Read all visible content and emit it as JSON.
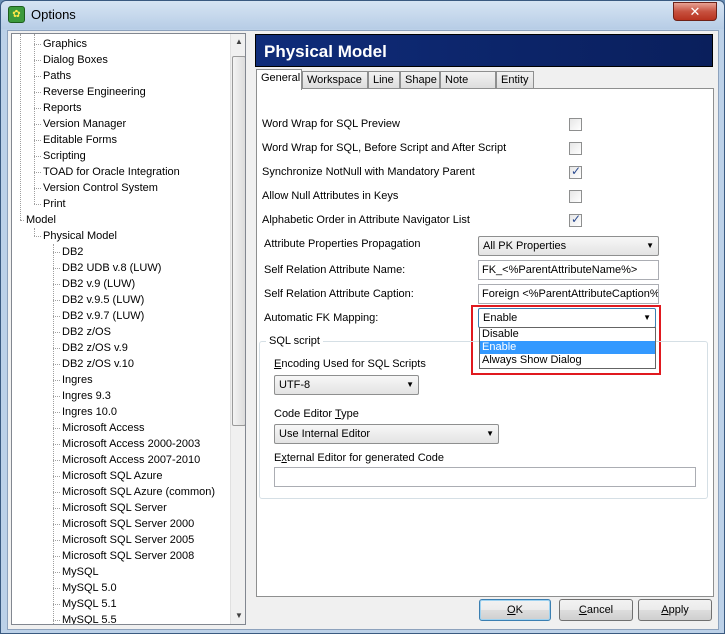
{
  "window": {
    "title": "Options",
    "icon": "erwin-app-icon",
    "close_label": "✕"
  },
  "tree": {
    "items": [
      {
        "label": "Graphics",
        "level": 2
      },
      {
        "label": "Dialog Boxes",
        "level": 2
      },
      {
        "label": "Paths",
        "level": 2
      },
      {
        "label": "Reverse Engineering",
        "level": 2
      },
      {
        "label": "Reports",
        "level": 2
      },
      {
        "label": "Version Manager",
        "level": 2
      },
      {
        "label": "Editable Forms",
        "level": 2
      },
      {
        "label": "Scripting",
        "level": 2
      },
      {
        "label": "TOAD for Oracle Integration",
        "level": 2
      },
      {
        "label": "Version Control System",
        "level": 2
      },
      {
        "label": "Print",
        "level": 2
      },
      {
        "label": "Model",
        "level": 1
      },
      {
        "label": "Physical Model",
        "level": 2
      },
      {
        "label": "DB2",
        "level": 3
      },
      {
        "label": "DB2 UDB v.8 (LUW)",
        "level": 3
      },
      {
        "label": "DB2 v.9 (LUW)",
        "level": 3
      },
      {
        "label": "DB2 v.9.5 (LUW)",
        "level": 3
      },
      {
        "label": "DB2 v.9.7 (LUW)",
        "level": 3
      },
      {
        "label": "DB2 z/OS",
        "level": 3
      },
      {
        "label": "DB2 z/OS v.9",
        "level": 3
      },
      {
        "label": "DB2 z/OS v.10",
        "level": 3
      },
      {
        "label": "Ingres",
        "level": 3
      },
      {
        "label": "Ingres 9.3",
        "level": 3
      },
      {
        "label": "Ingres 10.0",
        "level": 3
      },
      {
        "label": "Microsoft Access",
        "level": 3
      },
      {
        "label": "Microsoft Access 2000-2003",
        "level": 3
      },
      {
        "label": "Microsoft Access 2007-2010",
        "level": 3
      },
      {
        "label": "Microsoft SQL Azure",
        "level": 3
      },
      {
        "label": "Microsoft SQL Azure (common)",
        "level": 3
      },
      {
        "label": "Microsoft SQL Server",
        "level": 3
      },
      {
        "label": "Microsoft SQL Server 2000",
        "level": 3
      },
      {
        "label": "Microsoft SQL Server 2005",
        "level": 3
      },
      {
        "label": "Microsoft SQL Server 2008",
        "level": 3
      },
      {
        "label": "MySQL",
        "level": 3
      },
      {
        "label": "MySQL 5.0",
        "level": 3
      },
      {
        "label": "MySQL 5.1",
        "level": 3
      },
      {
        "label": "MySQL 5.5",
        "level": 3
      }
    ]
  },
  "panel": {
    "title": "Physical Model",
    "tabs": [
      "General",
      "Workspace",
      "Line",
      "Shape",
      "Note Line",
      "Entity"
    ],
    "active_tab": "General",
    "options": [
      {
        "label": "Word Wrap for SQL Preview",
        "checked": false
      },
      {
        "label": "Word Wrap for SQL, Before Script and After Script",
        "checked": false
      },
      {
        "label": "Synchronize NotNull with Mandatory Parent",
        "checked": true
      },
      {
        "label": "Allow Null Attributes in Keys",
        "checked": false
      },
      {
        "label": "Alphabetic Order in Attribute Navigator List",
        "checked": true
      }
    ],
    "attr_propagation": {
      "label": "Attribute Properties Propagation",
      "value": "All PK Properties"
    },
    "self_rel_name": {
      "label": "Self Relation Attribute Name:",
      "value": "FK_<%ParentAttributeName%>"
    },
    "self_rel_caption": {
      "label": "Self Relation Attribute Caption:",
      "value": "Foreign <%ParentAttributeCaption%>"
    },
    "fk_mapping": {
      "label": "Automatic FK Mapping:",
      "value": "Enable",
      "options": [
        "Disable",
        "Enable",
        "Always Show Dialog"
      ],
      "selected_index": 1
    },
    "sql_script": {
      "group_label": "SQL script",
      "encoding_label": "Encoding Used for SQL Scripts",
      "encoding_value": "UTF-8",
      "editor_type_label": "Code Editor Type",
      "editor_type_value": "Use Internal Editor",
      "external_editor_label": "External Editor for generated Code",
      "external_editor_value": ""
    }
  },
  "buttons": {
    "ok": "OK",
    "cancel": "Cancel",
    "apply": "Apply"
  },
  "colors": {
    "header_bg": "#0a246a",
    "highlight_border": "#e0191f",
    "selection": "#3399ff"
  }
}
